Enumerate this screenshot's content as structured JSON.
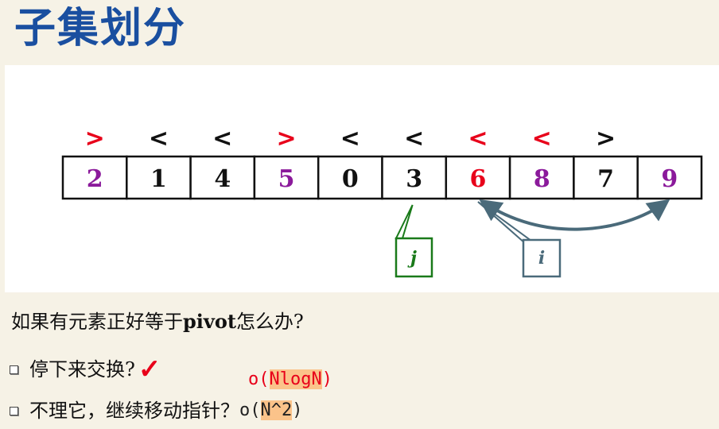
{
  "title": "子集划分",
  "colors": {
    "title": "#1a4fa0",
    "red": "#e8001a",
    "purple": "#8b1a9b",
    "black": "#111111",
    "green": "#1a7a1a",
    "slate": "#4a6a7a",
    "highlight": "#fbc38a"
  },
  "array": {
    "cells": [
      {
        "value": "2",
        "color": "purple",
        "mark": ">",
        "mark_color": "red"
      },
      {
        "value": "1",
        "color": "black",
        "mark": "<",
        "mark_color": "black"
      },
      {
        "value": "4",
        "color": "black",
        "mark": "<",
        "mark_color": "black"
      },
      {
        "value": "5",
        "color": "purple",
        "mark": ">",
        "mark_color": "red"
      },
      {
        "value": "0",
        "color": "black",
        "mark": "<",
        "mark_color": "black"
      },
      {
        "value": "3",
        "color": "black",
        "mark": "<",
        "mark_color": "black"
      },
      {
        "value": "6",
        "color": "red",
        "mark": "<",
        "mark_color": "red"
      },
      {
        "value": "8",
        "color": "purple",
        "mark": "<",
        "mark_color": "red"
      },
      {
        "value": "7",
        "color": "black",
        "mark": ">",
        "mark_color": "black"
      },
      {
        "value": "9",
        "color": "purple",
        "mark": "",
        "mark_color": "black"
      }
    ],
    "pointer_j": {
      "label": "j",
      "cell_index": 5
    },
    "pointer_i": {
      "label": "i",
      "cell_index": 6,
      "arrow_to_index": 9
    }
  },
  "question": {
    "prefix": "如果有元素正好等于",
    "bold": "pivot",
    "suffix": "怎么办?"
  },
  "bullets": [
    {
      "text": "停下来交换?",
      "check": "✓",
      "complexity_o": "o(",
      "complexity_value": "NlogN",
      "complexity_close": ")"
    },
    {
      "text": "不理它，继续移动指针？",
      "complexity_o": "o(",
      "complexity_value": "N^2",
      "complexity_close": ")"
    }
  ]
}
